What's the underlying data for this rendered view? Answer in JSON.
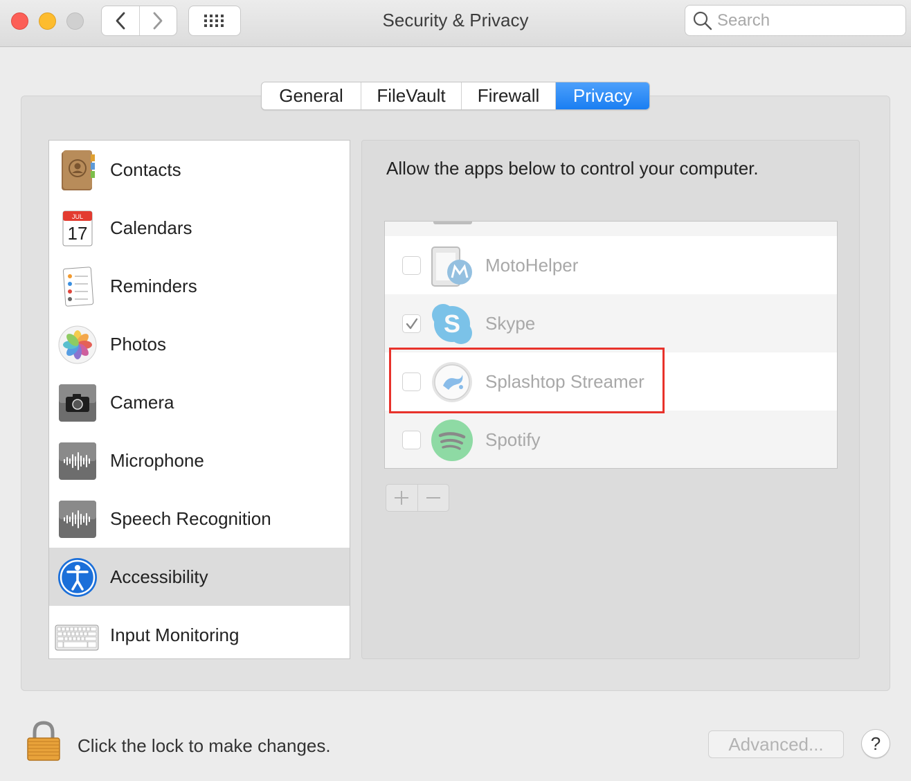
{
  "window": {
    "title": "Security & Privacy",
    "search_placeholder": "Search"
  },
  "tabs": [
    {
      "label": "General",
      "active": false
    },
    {
      "label": "FileVault",
      "active": false
    },
    {
      "label": "Firewall",
      "active": false
    },
    {
      "label": "Privacy",
      "active": true
    }
  ],
  "categories": [
    {
      "label": "Contacts",
      "icon": "contacts-icon"
    },
    {
      "label": "Calendars",
      "icon": "calendar-icon",
      "icon_month": "JUL",
      "icon_day": "17"
    },
    {
      "label": "Reminders",
      "icon": "reminders-icon"
    },
    {
      "label": "Photos",
      "icon": "photos-icon"
    },
    {
      "label": "Camera",
      "icon": "camera-icon"
    },
    {
      "label": "Microphone",
      "icon": "microphone-icon"
    },
    {
      "label": "Speech Recognition",
      "icon": "speech-recognition-icon"
    },
    {
      "label": "Accessibility",
      "icon": "accessibility-icon",
      "selected": true
    },
    {
      "label": "Input Monitoring",
      "icon": "keyboard-icon"
    }
  ],
  "main": {
    "description": "Allow the apps below to control your computer.",
    "apps": [
      {
        "name": "MotoHelper",
        "checked": false,
        "icon": "motohelper-icon"
      },
      {
        "name": "Skype",
        "checked": true,
        "icon": "skype-icon"
      },
      {
        "name": "Splashtop Streamer",
        "checked": false,
        "icon": "splashtop-icon",
        "highlighted": true
      },
      {
        "name": "Spotify",
        "checked": false,
        "icon": "spotify-icon"
      }
    ],
    "add_symbol": "+",
    "remove_symbol": "—"
  },
  "footer": {
    "lock_text": "Click the lock to make changes.",
    "advanced_label": "Advanced...",
    "help_label": "?"
  },
  "colors": {
    "accent": "#1a7ef2",
    "highlight_border": "#e8322b",
    "selected_row": "#dcdcdc"
  }
}
